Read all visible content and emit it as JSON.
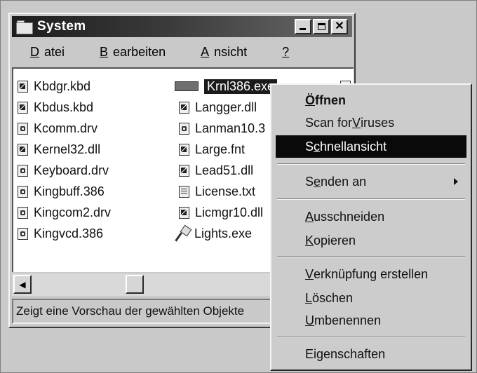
{
  "window": {
    "title": "System",
    "menu": [
      {
        "pre": "",
        "u": "D",
        "post": "atei"
      },
      {
        "pre": "",
        "u": "B",
        "post": "earbeiten"
      },
      {
        "pre": "",
        "u": "A",
        "post": "nsicht"
      },
      {
        "pre": "",
        "u": "?",
        "post": ""
      }
    ],
    "status": "Zeigt eine Vorschau der gewählten Objekte"
  },
  "files": {
    "col1": [
      "Kbdgr.kbd",
      "Kbdus.kbd",
      "Kcomm.drv",
      "Kernel32.dll",
      "Keyboard.drv",
      "Kingbuff.386",
      "Kingcom2.drv",
      "Kingvcd.386"
    ],
    "col2": [
      "Krnl386.exe",
      "Langger.dll",
      "Lanman10.3",
      "Large.fnt",
      "Lead51.dll",
      "License.txt",
      "Licmgr10.dll",
      "Lights.exe"
    ],
    "selected": "Krnl386.exe"
  },
  "context_menu": {
    "open": {
      "pre": "",
      "u": "Ö",
      "post": "ffnen"
    },
    "scan": {
      "pre": "Scan for ",
      "u": "V",
      "post": "iruses"
    },
    "quick": {
      "pre": "S",
      "u": "c",
      "post": "hnellansicht"
    },
    "send": {
      "pre": "S",
      "u": "e",
      "post": "nden an"
    },
    "cut": {
      "pre": "",
      "u": "A",
      "post": "usschneiden"
    },
    "copy": {
      "pre": "",
      "u": "K",
      "post": "opieren"
    },
    "link": {
      "pre": "",
      "u": "V",
      "post": "erknüpfung erstellen"
    },
    "delete": {
      "pre": "",
      "u": "L",
      "post": "öschen"
    },
    "rename": {
      "pre": "",
      "u": "U",
      "post": "mbenennen"
    },
    "props": {
      "pre": "Ei",
      "u": "g",
      "post": "enschaften"
    }
  }
}
